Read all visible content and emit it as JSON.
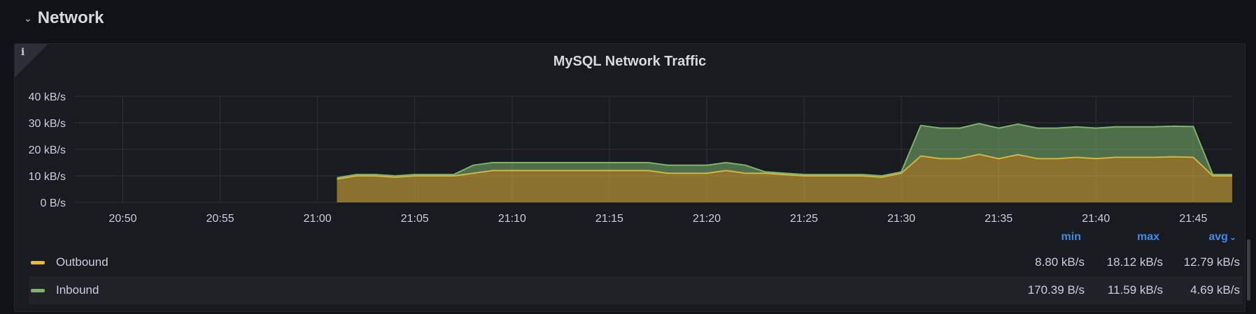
{
  "row": {
    "title": "Network",
    "chevron_icon": "chevron-down-icon"
  },
  "panel": {
    "title": "MySQL Network Traffic",
    "info_icon": "i"
  },
  "legend": {
    "headers": {
      "min": "min",
      "max": "max",
      "avg": "avg"
    },
    "rows": [
      {
        "name": "Outbound",
        "color": "#eab839",
        "min": "8.80 kB/s",
        "max": "18.12 kB/s",
        "avg": "12.79 kB/s"
      },
      {
        "name": "Inbound",
        "color": "#7eb26d",
        "min": "170.39 B/s",
        "max": "11.59 kB/s",
        "avg": "4.69 kB/s"
      }
    ]
  },
  "chart_data": {
    "type": "area",
    "stacked": true,
    "title": "MySQL Network Traffic",
    "xlabel": "",
    "ylabel": "",
    "xlim": [
      "20:47:30",
      "21:47:00"
    ],
    "ylim": [
      0,
      40
    ],
    "y_unit": "kB/s",
    "yticks": [
      0,
      10,
      20,
      30,
      40
    ],
    "ytick_labels": [
      "0 B/s",
      "10 kB/s",
      "20 kB/s",
      "30 kB/s",
      "40 kB/s"
    ],
    "xticks": [
      "20:50",
      "20:55",
      "21:00",
      "21:05",
      "21:10",
      "21:15",
      "21:20",
      "21:25",
      "21:30",
      "21:35",
      "21:40",
      "21:45"
    ],
    "grid": true,
    "legend_position": "bottom",
    "x": [
      "21:01",
      "21:02",
      "21:03",
      "21:04",
      "21:05",
      "21:06",
      "21:07",
      "21:08",
      "21:09",
      "21:10",
      "21:11",
      "21:12",
      "21:13",
      "21:14",
      "21:15",
      "21:16",
      "21:17",
      "21:18",
      "21:19",
      "21:20",
      "21:21",
      "21:22",
      "21:23",
      "21:24",
      "21:25",
      "21:26",
      "21:27",
      "21:28",
      "21:29",
      "21:30",
      "21:31",
      "21:32",
      "21:33",
      "21:34",
      "21:35",
      "21:36",
      "21:37",
      "21:38",
      "21:39",
      "21:40",
      "21:41",
      "21:42",
      "21:43",
      "21:44",
      "21:45",
      "21:46",
      "21:47"
    ],
    "series": [
      {
        "name": "Outbound",
        "color": "#eab839",
        "values": [
          8.8,
          10,
          10,
          9.5,
          10,
          10,
          10,
          11,
          12,
          12,
          12,
          12,
          12,
          12,
          12,
          12,
          12,
          11,
          11,
          11,
          12,
          11,
          11,
          10.5,
          10,
          10,
          10,
          10,
          9.5,
          11,
          17.5,
          16.5,
          16.5,
          18.12,
          16.5,
          18,
          16.5,
          16.5,
          17,
          16.5,
          17,
          17,
          17,
          17.2,
          17,
          10,
          10
        ]
      },
      {
        "name": "Inbound",
        "color": "#7eb26d",
        "values": [
          0.5,
          0.5,
          0.5,
          0.5,
          0.5,
          0.5,
          0.5,
          3,
          3,
          3,
          3,
          3,
          3,
          3,
          3,
          3,
          3,
          3,
          3,
          3,
          3,
          3,
          0.5,
          0.5,
          0.5,
          0.5,
          0.5,
          0.5,
          0.5,
          0.5,
          11.5,
          11.5,
          11.5,
          11.59,
          11.5,
          11.5,
          11.5,
          11.5,
          11.5,
          11.5,
          11.5,
          11.5,
          11.5,
          11.5,
          11.59,
          0.5,
          0.5
        ]
      }
    ]
  }
}
